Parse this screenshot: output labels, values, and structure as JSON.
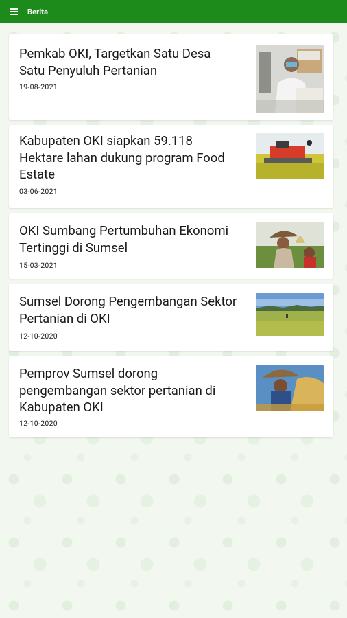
{
  "appbar": {
    "title": "Berita",
    "menu_icon": "hamburger-menu-icon",
    "color": "#1c8b1c"
  },
  "news": [
    {
      "title": "Pemkab OKI, Targetkan Satu Desa Satu Penyuluh Pertanian",
      "date": "19-08-2021"
    },
    {
      "title": "Kabupaten OKI siapkan 59.118 Hektare lahan dukung program Food Estate",
      "date": "03-06-2021"
    },
    {
      "title": "OKI Sumbang Pertumbuhan Ekonomi Tertinggi di Sumsel",
      "date": "15-03-2021"
    },
    {
      "title": "Sumsel Dorong Pengembangan Sektor Pertanian di OKI",
      "date": "12-10-2020"
    },
    {
      "title": "Pemprov Sumsel dorong pengembangan sektor pertanian di Kabupaten OKI",
      "date": "12-10-2020"
    }
  ]
}
